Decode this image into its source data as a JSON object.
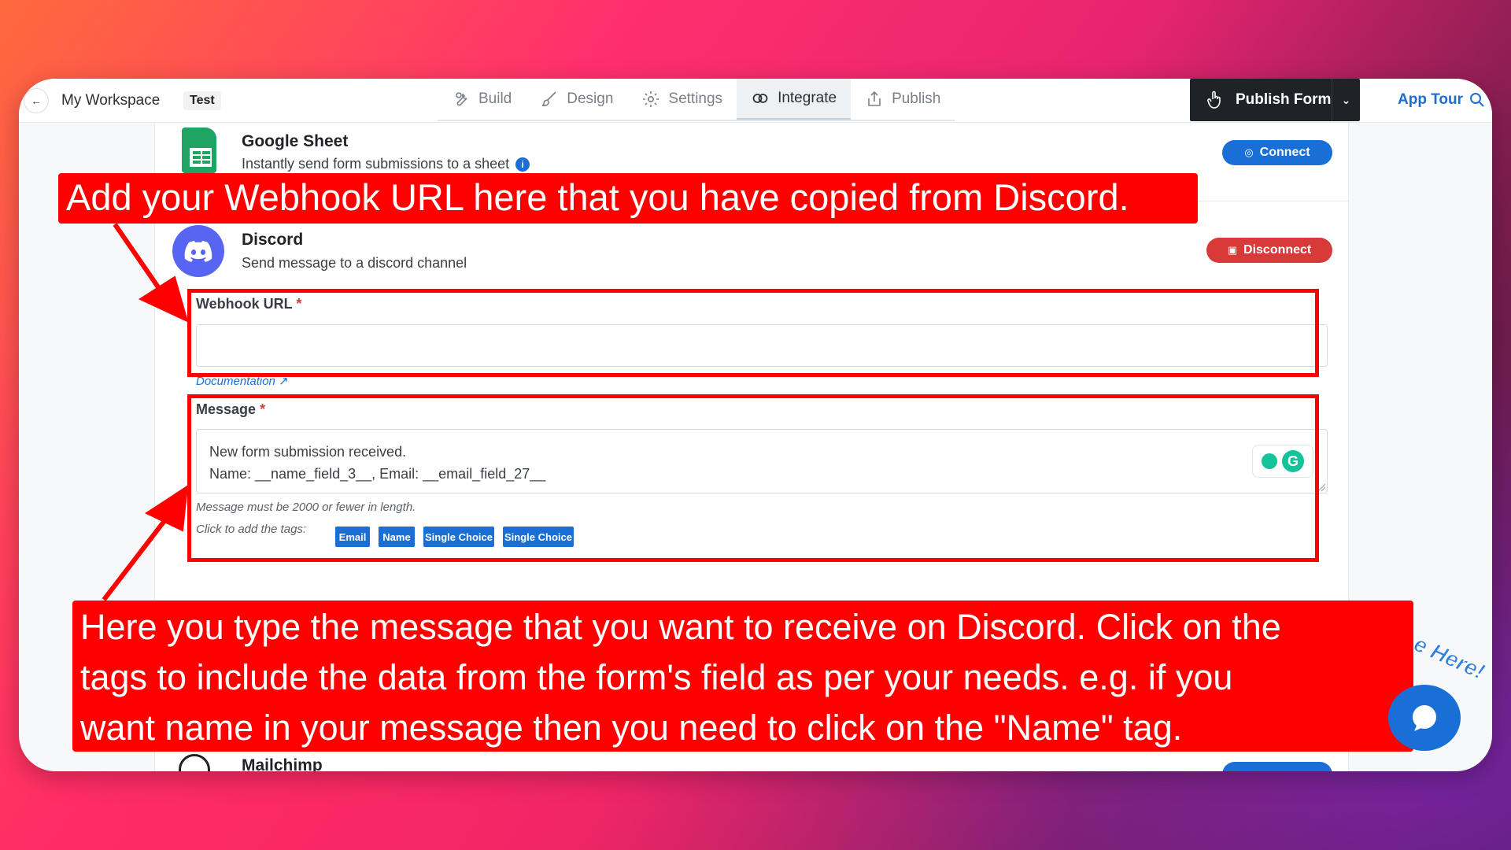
{
  "header": {
    "back_icon": "arrow-left-icon",
    "workspace": "My Workspace",
    "form_tag": "Test",
    "tabs": [
      {
        "label": "Build",
        "icon": "wrench-icon"
      },
      {
        "label": "Design",
        "icon": "brush-icon"
      },
      {
        "label": "Settings",
        "icon": "gear-icon"
      },
      {
        "label": "Integrate",
        "icon": "link-icon"
      },
      {
        "label": "Publish",
        "icon": "share-icon"
      }
    ],
    "active_tab": "Integrate",
    "publish_label": "Publish Form",
    "app_tour_label": "App Tour"
  },
  "google_sheet": {
    "title": "Google Sheet",
    "description": "Instantly send form submissions to a sheet",
    "connect_label": "Connect"
  },
  "discord": {
    "title": "Discord",
    "description": "Send message to a discord channel",
    "disconnect_label": "Disconnect",
    "webhook_label": "Webhook URL",
    "required_mark": "*",
    "webhook_value": "",
    "documentation_label": "Documentation",
    "message_label": "Message",
    "message_line1": "New form submission received.",
    "message_line2": "Name:  __name_field_3__, Email:  __email_field_27__",
    "length_hint": "Message must be 2000 or fewer in length.",
    "tags_hint": "Click to add the tags:",
    "tags": [
      "Email",
      "Name",
      "Single Choice",
      "Single Choice"
    ]
  },
  "mailchimp": {
    "title": "Mailchimp"
  },
  "annotations": {
    "top": "Add your Webhook URL here that you have copied from Discord.",
    "bottom_line1": "Here you type the message that you want to receive on Discord. Click on the",
    "bottom_line2": "tags to include the data from the form's field as per your needs. e.g. if you",
    "bottom_line3": "want name in your message then you need to click on the \"Name\" tag."
  },
  "chat_widget": {
    "text": "e Here!"
  },
  "colors": {
    "accent_blue": "#1a6fd6",
    "danger_red": "#d83a3a",
    "annotation_red": "#ff0000",
    "discord_blurple": "#5865f2",
    "sheets_green": "#1fa463"
  }
}
